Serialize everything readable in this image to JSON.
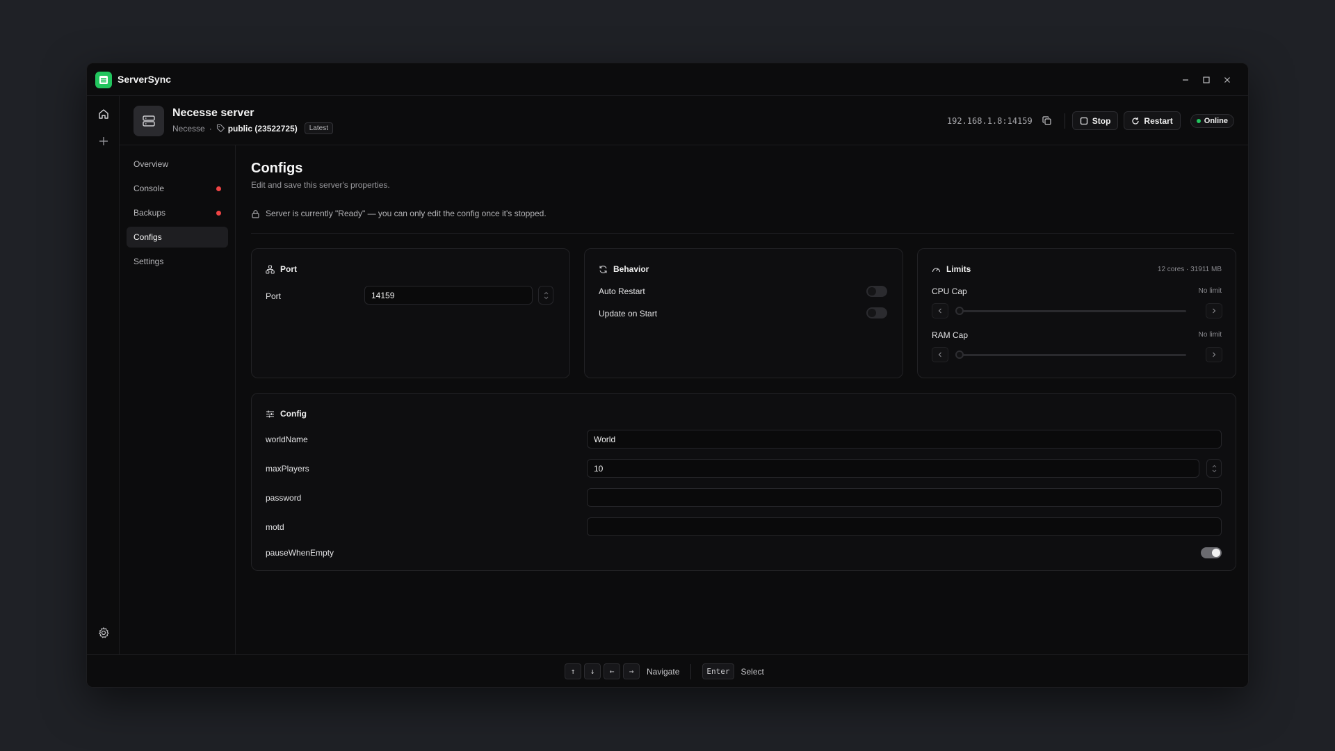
{
  "app": {
    "title": "ServerSync"
  },
  "server": {
    "name": "Necesse server",
    "game": "Necesse",
    "separator": "·",
    "branch": "public (23522725)",
    "version_badge": "Latest",
    "address": "192.168.1.8:14159",
    "stop_label": "Stop",
    "restart_label": "Restart",
    "status": "Online"
  },
  "nav": {
    "items": [
      {
        "label": "Overview"
      },
      {
        "label": "Console"
      },
      {
        "label": "Backups"
      },
      {
        "label": "Configs"
      },
      {
        "label": "Settings"
      }
    ],
    "active": "Configs"
  },
  "page": {
    "title": "Configs",
    "subtitle": "Edit and save this server's properties.",
    "notice": "Server is currently \"Ready\" — you can only edit the config once it's stopped."
  },
  "port_card": {
    "title": "Port",
    "label": "Port",
    "value": "14159"
  },
  "behavior_card": {
    "title": "Behavior",
    "auto_restart_label": "Auto Restart",
    "auto_restart": false,
    "update_on_start_label": "Update on Start",
    "update_on_start": false
  },
  "limits_card": {
    "title": "Limits",
    "summary": "12 cores · 31911 MB",
    "cpu_label": "CPU Cap",
    "cpu_value": "No limit",
    "cpu_fraction": 0,
    "ram_label": "RAM Cap",
    "ram_value": "No limit",
    "ram_fraction": 0
  },
  "config_card": {
    "title": "Config",
    "world_name_label": "worldName",
    "world_name_value": "World",
    "max_players_label": "maxPlayers",
    "max_players_value": "10",
    "password_label": "password",
    "password_value": "",
    "motd_label": "motd",
    "motd_value": "",
    "pause_when_empty_label": "pauseWhenEmpty",
    "pause_when_empty": true
  },
  "footer": {
    "navigate_keys": [
      "↑",
      "↓",
      "←",
      "→"
    ],
    "navigate_label": "Navigate",
    "select_key": "Enter",
    "select_label": "Select"
  },
  "colors": {
    "accent": "#22c55e",
    "alert_dot": "#ef4444",
    "background": "#0c0c0d"
  }
}
